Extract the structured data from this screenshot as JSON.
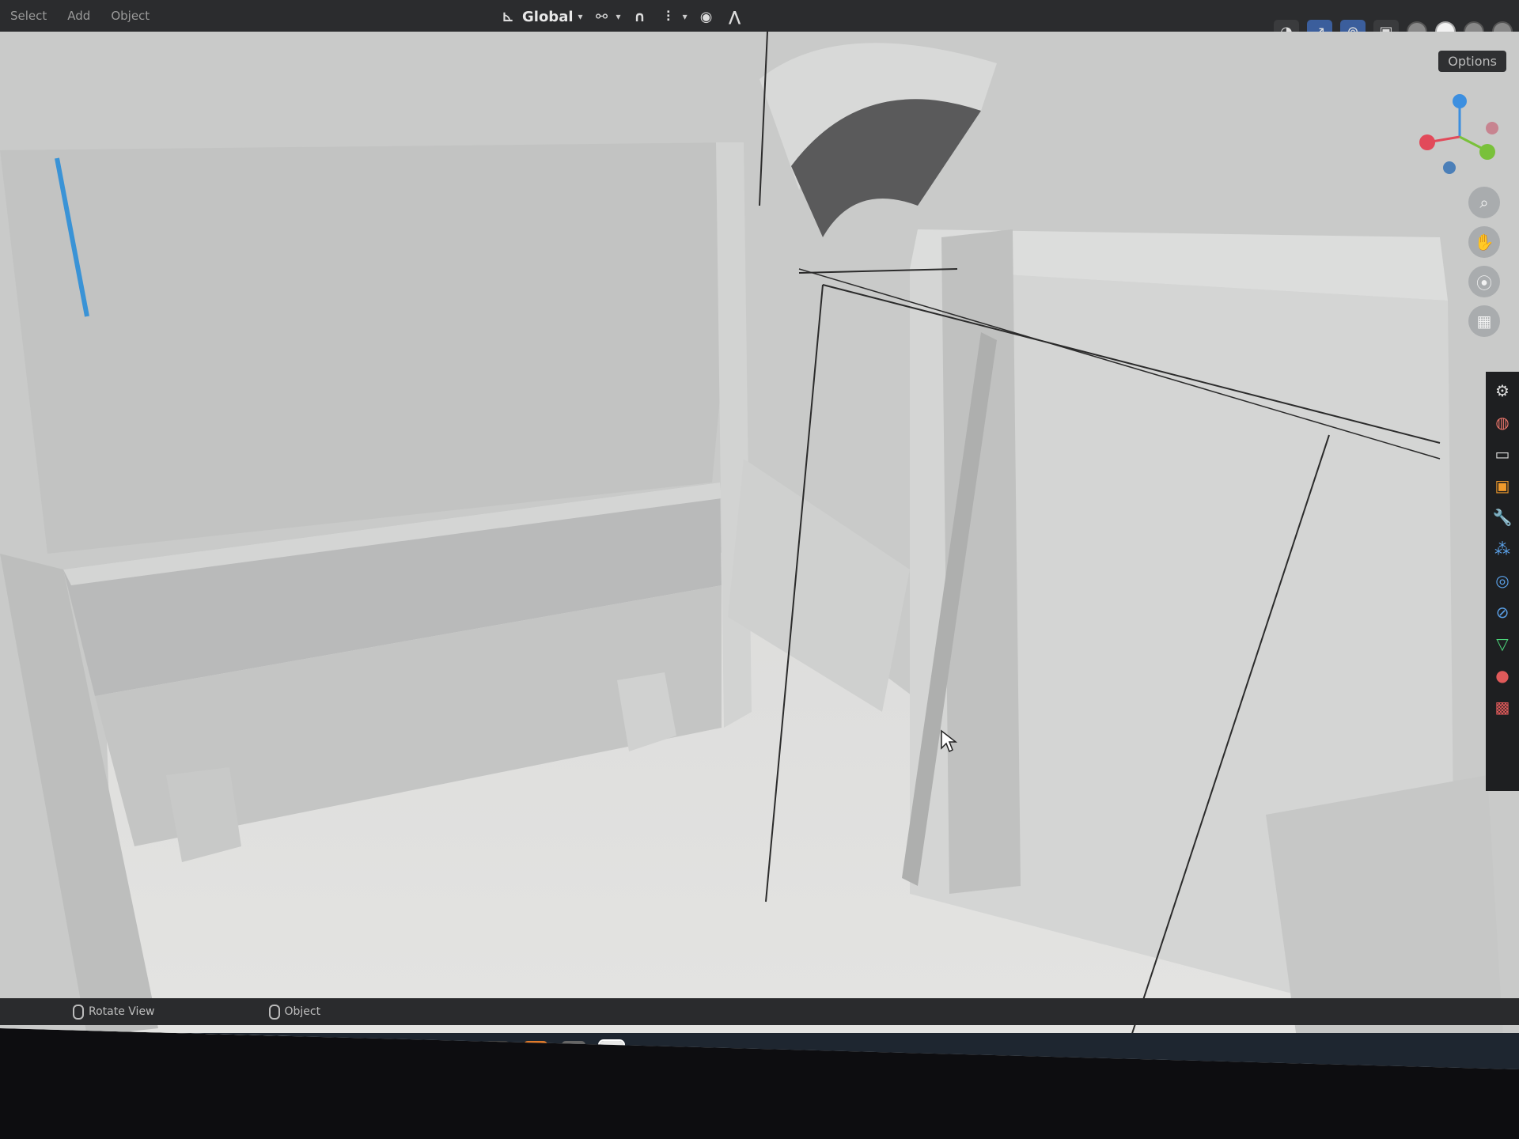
{
  "menubar": {
    "items": [
      "Select",
      "Add",
      "Object"
    ]
  },
  "header": {
    "transform_orientation": "Global",
    "options_label": "Options"
  },
  "status": {
    "rotate_view": "Rotate View",
    "mode": "Object"
  },
  "icons": {
    "orientation": "axes-icon",
    "pivot": "pivot-icon",
    "snap": "magnet-icon",
    "snap_target": "snap-grid-icon",
    "proportional": "proportional-edit-icon",
    "falloff": "falloff-curve-icon",
    "visibility": "eye-icon",
    "gizmo_toggle": "gizmo-icon",
    "overlay": "overlay-icon",
    "xray": "xray-icon",
    "zoom": "zoom-icon",
    "pan": "hand-icon",
    "camera": "camera-icon",
    "ortho": "grid-icon"
  },
  "colors": {
    "active_tab": "#3b5e9c",
    "axis_x": "#e24a5a",
    "axis_y": "#79c13a",
    "axis_z": "#3c8fe0"
  }
}
